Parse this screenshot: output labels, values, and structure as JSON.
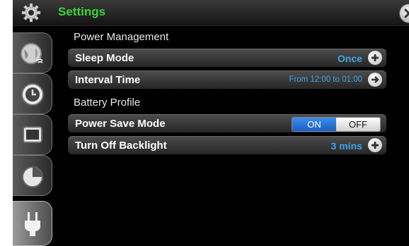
{
  "window": {
    "title": "Settings"
  },
  "sidebar": {
    "tabs": [
      {
        "icon": "satellite-icon",
        "active": false
      },
      {
        "icon": "clock-icon",
        "active": false
      },
      {
        "icon": "display-icon",
        "active": false
      },
      {
        "icon": "pie-chart-icon",
        "active": false
      },
      {
        "icon": "plug-icon",
        "active": true
      }
    ]
  },
  "sections": {
    "power": {
      "title": "Power Management"
    },
    "battery": {
      "title": "Battery Profile"
    }
  },
  "rows": {
    "sleep_mode": {
      "label": "Sleep Mode",
      "value": "Once"
    },
    "interval_time": {
      "label": "Interval Time",
      "value": "From 12:00 to 01:00"
    },
    "power_save_mode": {
      "label": "Power Save Mode",
      "on_label": "ON",
      "off_label": "OFF",
      "selected": "ON"
    },
    "turn_off_backlight": {
      "label": "Turn Off Backlight",
      "value": "3 mins"
    }
  },
  "colors": {
    "title": "#3fd23a",
    "value": "#3fa6ea",
    "toggle_on": "#2a74d6"
  }
}
